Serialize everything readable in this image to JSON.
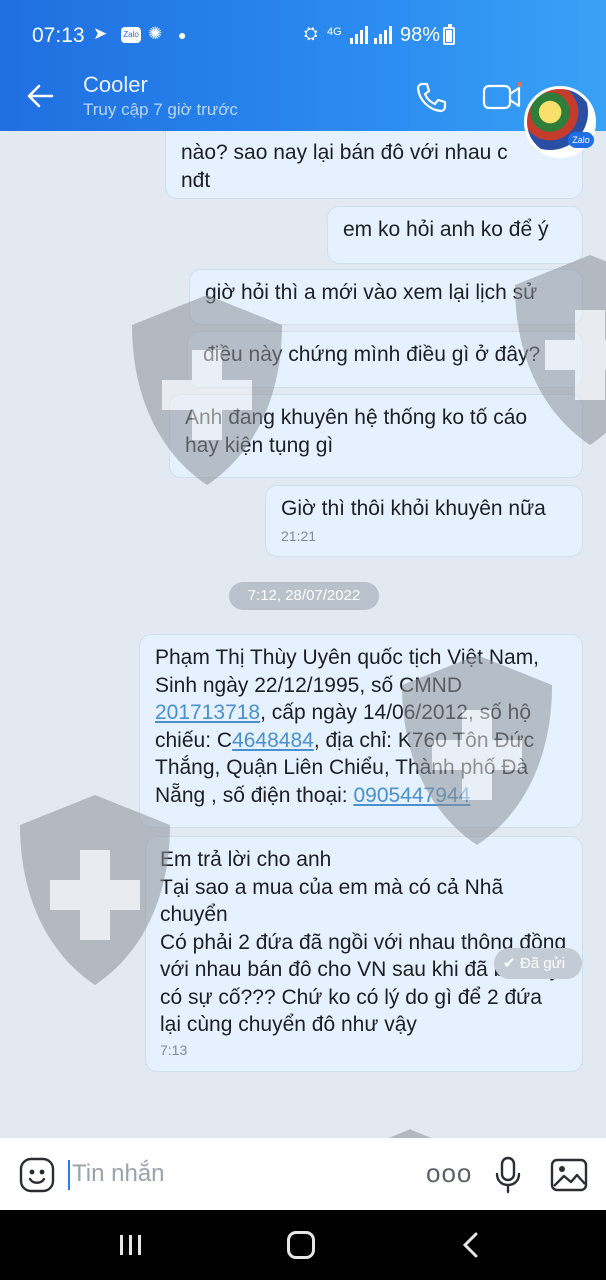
{
  "status_bar": {
    "time": "07:13",
    "network": "4G",
    "battery": "98%",
    "icons": [
      "telegram-icon",
      "zalo-icon",
      "weather-icon",
      "dot-icon",
      "data-saver-icon",
      "4g-icon",
      "signal-icon",
      "signal-icon",
      "battery-icon"
    ]
  },
  "header": {
    "contact_name": "Cooler",
    "last_seen": "Truy cập 7 giờ trước",
    "avatar_badge": "Zalo"
  },
  "messages": [
    {
      "text": "nào? sao nay lại bán đô với nhau c\nnđt",
      "time": ""
    },
    {
      "text": "em ko hỏi anh ko để ý",
      "time": ""
    },
    {
      "text": "giờ hỏi thì a mới vào xem lại lịch sử",
      "time": ""
    },
    {
      "text": "điều này chứng mình điều gì ở đây?",
      "time": ""
    },
    {
      "text": "Anh đang khuyên hệ thống ko tố cáo\nhay kiện tụng gì",
      "time": ""
    },
    {
      "text": "Giờ thì thôi khỏi khuyên nữa",
      "time": "21:21"
    }
  ],
  "date_separator": "7:12, 28/07/2022",
  "message_id": {
    "p1": "Phạm Thị Thùy Uyên quốc tịch Việt Nam, Sinh ngày 22/12/1995, số CMND ",
    "cmnd": "201713718",
    "p2": ", cấp ngày 14/06/2012, số hộ chiếu: C",
    "passport": "4648484",
    "p3": ", địa chỉ:  K760 Tôn Đức Thắng, Quận Liên Chiểu, Thành phố Đà Nẵng , số điện thoại: ",
    "phone": "0905447944"
  },
  "message_last": {
    "text": "Em trả lời cho anh\nTại sao a mua của em mà có cả Nhã chuyển\nCó phải 2 đứa đã ngồi với nhau thông đồng với nhau bán đô cho VN sau khi đã biết cty có sự cố??? Chứ ko có lý do gì để 2 đứa lại cùng chuyển đô như vậy",
    "time": "7:13"
  },
  "delivery_status": "Đã gửi",
  "input": {
    "placeholder": "Tin nhắn"
  },
  "colors": {
    "header": "#2b8bf0",
    "bubble": "#e5f1fe",
    "chat_bg": "#e2e9f1",
    "link": "#4a8fd0"
  }
}
